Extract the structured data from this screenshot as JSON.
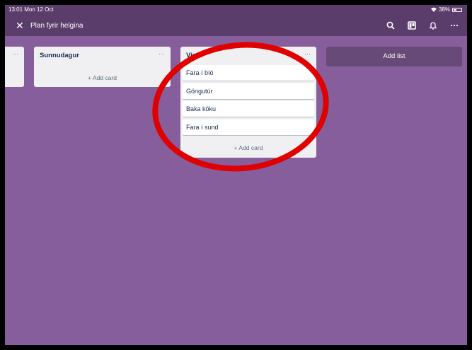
{
  "status": {
    "time": "13:01  Mon 12 Oct",
    "battery_percent": "38%"
  },
  "header": {
    "close_glyph": "✕",
    "title": "Plan fyrir helgina"
  },
  "lists": {
    "left_partial": {
      "menu": "···"
    },
    "sunnudagur": {
      "title": "Sunnudagur",
      "menu": "···",
      "add_card": "+ Add card"
    },
    "vinna": {
      "title": "Vinja",
      "menu": "···",
      "cards": [
        "Fara í bíó",
        "Göngutúr",
        "Baka köku",
        "Fara í sund"
      ],
      "add_card": "+ Add card"
    }
  },
  "add_list": "Add list",
  "colors": {
    "board_bg": "#865e9c",
    "header_bg": "#5b3d6b",
    "annotation": "#e00000"
  }
}
